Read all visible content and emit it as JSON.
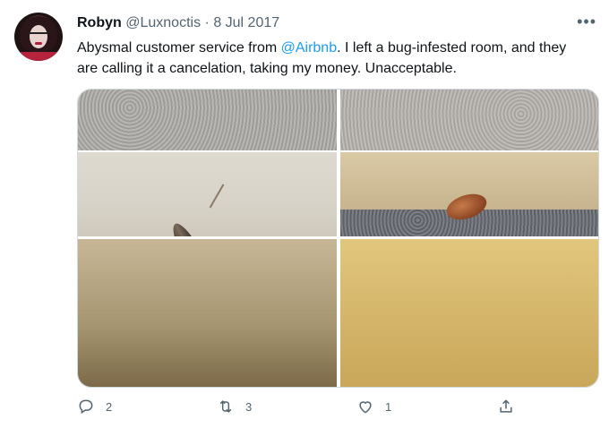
{
  "tweet": {
    "display_name": "Robyn",
    "handle": "@Luxnoctis",
    "separator": "·",
    "date": "8 Jul 2017",
    "text_before_mention": "Abysmal customer service from ",
    "mention": "@Airbnb",
    "text_after_mention": ". I left a bug-infested room, and they are calling it a cancelation, taking my money. Unacceptable."
  },
  "actions": {
    "reply_count": "2",
    "retweet_count": "3",
    "like_count": "1"
  },
  "colors": {
    "accent": "#1d9bf0",
    "text": "#0f1419",
    "muted": "#536471",
    "border": "#cfd9de"
  },
  "icons": [
    "more-icon",
    "reply-icon",
    "retweet-icon",
    "like-icon",
    "share-icon"
  ]
}
